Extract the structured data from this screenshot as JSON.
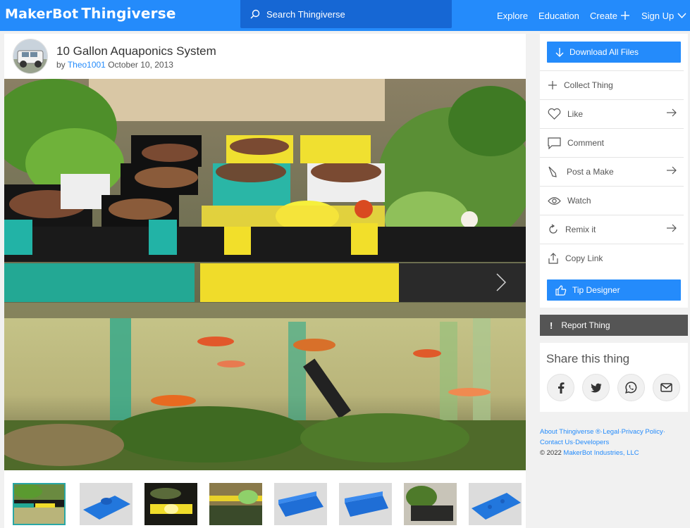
{
  "header": {
    "brand_maker": "MakerBot",
    "brand_thingiverse": "Thingiverse",
    "search_placeholder": "Search Thingiverse",
    "nav": {
      "explore": "Explore",
      "education": "Education",
      "create": "Create",
      "signup": "Sign Up"
    },
    "colors": {
      "bar": "#248bfb",
      "search": "#1667d4"
    }
  },
  "thing": {
    "title": "10 Gallon Aquaponics System",
    "by": "by",
    "author": "Theo1001",
    "date": "October 10, 2013"
  },
  "gallery": {
    "thumb_count": 8,
    "active_index": 0
  },
  "actions": {
    "download": "Download All Files",
    "collect": "Collect Thing",
    "like": "Like",
    "comment": "Comment",
    "post_make": "Post a Make",
    "watch": "Watch",
    "remix": "Remix it",
    "copy_link": "Copy Link",
    "tip": "Tip Designer",
    "report": "Report Thing"
  },
  "share": {
    "title": "Share this thing",
    "icons": [
      "facebook-icon",
      "twitter-icon",
      "whatsapp-icon",
      "email-icon"
    ]
  },
  "footer": {
    "about": "About Thingiverse ®",
    "legal": "Legal",
    "privacy": "Privacy Policy",
    "contact": "Contact Us",
    "developers": "Developers",
    "copyright": "©  2022",
    "company": "MakerBot Industries, LLC"
  }
}
